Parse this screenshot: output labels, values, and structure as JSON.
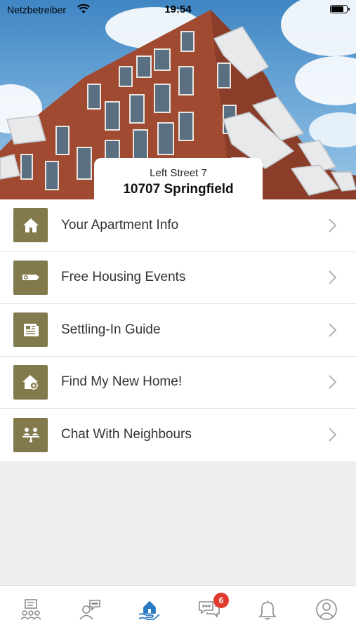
{
  "status_bar": {
    "carrier": "Netzbetreiber",
    "time": "19:54",
    "battery_level": 0.9
  },
  "address": {
    "street": "Left Street 7",
    "city": "10707 Springfield"
  },
  "menu": {
    "items": [
      {
        "label": "Your Apartment Info",
        "icon": "house-icon"
      },
      {
        "label": "Free Housing Events",
        "icon": "ticket-icon"
      },
      {
        "label": "Settling-In Guide",
        "icon": "newspaper-icon"
      },
      {
        "label": "Find My New Home!",
        "icon": "add-home-icon"
      },
      {
        "label": "Chat With Neighbours",
        "icon": "neighbours-icon"
      }
    ]
  },
  "tabbar": {
    "items": [
      {
        "icon": "community-board-icon"
      },
      {
        "icon": "person-chat-icon"
      },
      {
        "icon": "home-hand-icon",
        "active": true
      },
      {
        "icon": "messages-icon",
        "badge": "6"
      },
      {
        "icon": "bell-icon"
      },
      {
        "icon": "profile-icon"
      }
    ]
  },
  "colors": {
    "accent": "#827a4c",
    "active_tab": "#2a7bc4",
    "badge": "#e03a2f",
    "tab_icon": "#8a8a8a"
  }
}
